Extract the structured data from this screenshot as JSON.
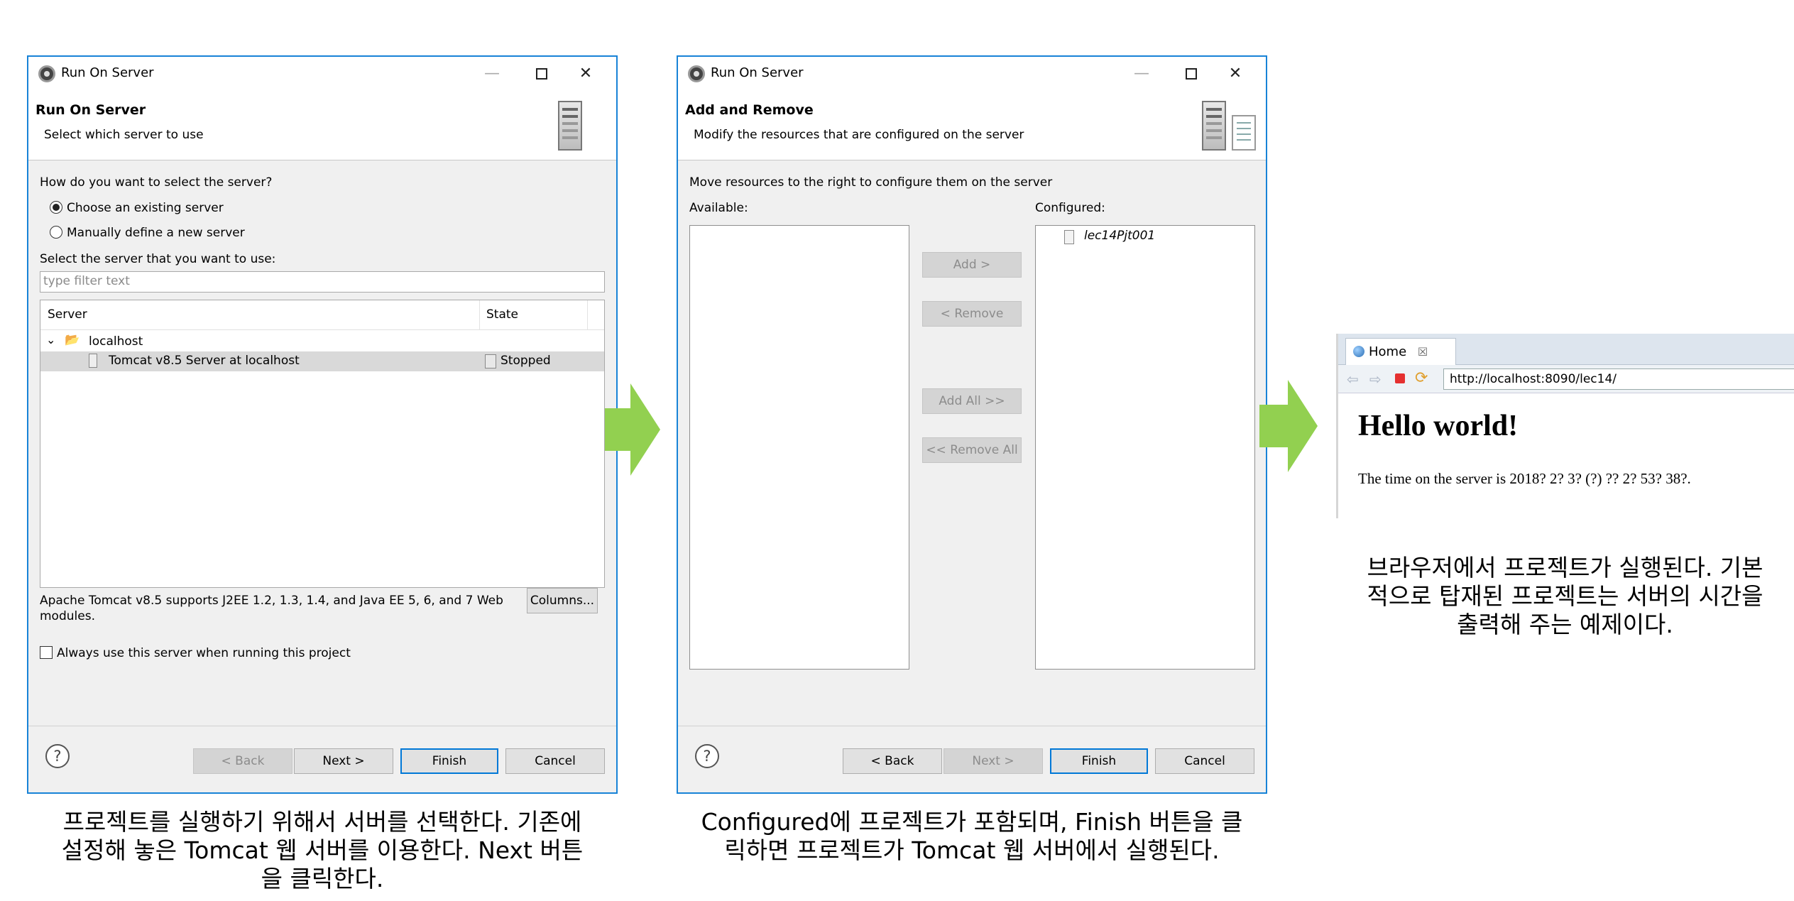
{
  "dialog1": {
    "window_title": "Run On Server",
    "header_title": "Run On Server",
    "header_subtitle": "Select which server to use",
    "question": "How do you want to select the server?",
    "radio_existing": "Choose an existing server",
    "radio_manual": "Manually define a new server",
    "select_label": "Select the server that you want to use:",
    "filter_placeholder": "type filter text",
    "columns": [
      "Server",
      "State"
    ],
    "tree_root": "localhost",
    "tree_item": "Tomcat v8.5 Server at localhost",
    "tree_item_state": "Stopped",
    "description_line1": "Apache Tomcat v8.5 supports J2EE 1.2, 1.3, 1.4, and Java EE 5, 6, and 7 Web",
    "description_line2": "modules.",
    "columns_button": "Columns...",
    "always_use": "Always use this server when running this project",
    "buttons": {
      "back": "< Back",
      "next": "Next >",
      "finish": "Finish",
      "cancel": "Cancel"
    },
    "help": "?"
  },
  "dialog2": {
    "window_title": "Run On Server",
    "header_title": "Add and Remove",
    "header_subtitle": "Modify the resources that are configured on the server",
    "instruction": "Move resources to the right to configure them on the server",
    "available_label": "Available:",
    "configured_label": "Configured:",
    "configured_item": "lec14Pjt001",
    "add": "Add >",
    "remove": "< Remove",
    "add_all": "Add All >>",
    "remove_all": "<< Remove All",
    "buttons": {
      "back": "< Back",
      "next": "Next >",
      "finish": "Finish",
      "cancel": "Cancel"
    },
    "help": "?"
  },
  "browser": {
    "tab_label": "Home",
    "tab_close": "☒",
    "url": "http://localhost:8090/lec14/",
    "heading": "Hello world!",
    "body_text": "The time on the server is 2018? 2? 3? (?) ?? 2? 53? 38?."
  },
  "captions": {
    "caption1": [
      "프로젝트를 실행하기 위해서 서버를 선택한다. 기존에",
      "설정해 놓은 Tomcat 웹 서버를 이용한다. Next 버튼",
      "을 클릭한다."
    ],
    "caption2": [
      "Configured에 프로젝트가 포함되며, Finish 버튼을 클",
      "릭하면 프로젝트가 Tomcat 웹 서버에서 실행된다."
    ],
    "caption3": [
      "브라우저에서 프로젝트가 실행된다. 기본",
      "적으로 탑재된 프로젝트는 서버의 시간을",
      "출력해 주는 예제이다."
    ]
  },
  "colors": {
    "arrow": "#92d050",
    "window_border": "#1883d7",
    "dialog_bg": "#f0f0f0"
  }
}
